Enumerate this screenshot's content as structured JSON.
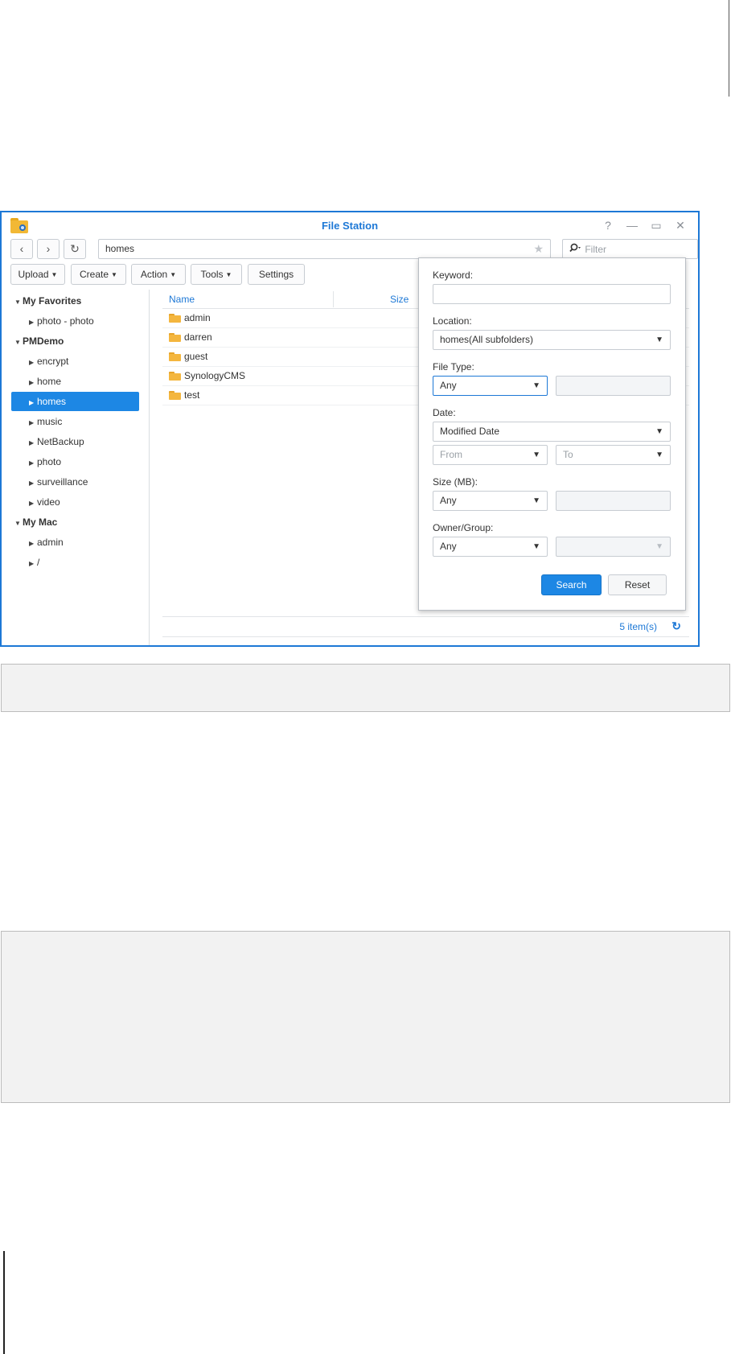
{
  "window": {
    "title": "File Station",
    "controls": [
      "?",
      "—",
      "▭",
      "✕"
    ]
  },
  "nav": {
    "back_icon": "‹",
    "forward_icon": "›",
    "refresh_icon": "↻",
    "path": "homes",
    "star_icon": "★",
    "filter_placeholder": "Filter"
  },
  "toolbar": {
    "upload": "Upload",
    "create": "Create",
    "action": "Action",
    "tools": "Tools",
    "settings": "Settings"
  },
  "sidebar": {
    "items": [
      {
        "label": "My Favorites",
        "group": true
      },
      {
        "label": "photo - photo",
        "group": false
      },
      {
        "label": "PMDemo",
        "group": true
      },
      {
        "label": "encrypt",
        "group": false
      },
      {
        "label": "home",
        "group": false
      },
      {
        "label": "homes",
        "group": false,
        "selected": true
      },
      {
        "label": "music",
        "group": false
      },
      {
        "label": "NetBackup",
        "group": false
      },
      {
        "label": "photo",
        "group": false
      },
      {
        "label": "surveillance",
        "group": false
      },
      {
        "label": "video",
        "group": false
      },
      {
        "label": "My Mac",
        "group": true
      },
      {
        "label": "admin",
        "group": false
      },
      {
        "label": "/",
        "group": false
      }
    ]
  },
  "file_list": {
    "columns": [
      "Name",
      "Size"
    ],
    "rows": [
      "admin",
      "darren",
      "guest",
      "SynologyCMS",
      "test"
    ],
    "item_count": "5 item(s)"
  },
  "search_panel": {
    "keyword_label": "Keyword:",
    "keyword_value": "",
    "location_label": "Location:",
    "location_value": "homes(All subfolders)",
    "file_type_label": "File Type:",
    "file_type_value": "Any",
    "date_label": "Date:",
    "date_value": "Modified Date",
    "from_placeholder": "From",
    "to_placeholder": "To",
    "size_label": "Size (MB):",
    "size_value": "Any",
    "owner_label": "Owner/Group:",
    "owner_value": "Any",
    "search_button": "Search",
    "reset_button": "Reset"
  },
  "colors": {
    "accent": "#1d78d6",
    "selected": "#1d87e4",
    "folder": "#f4b63e"
  }
}
